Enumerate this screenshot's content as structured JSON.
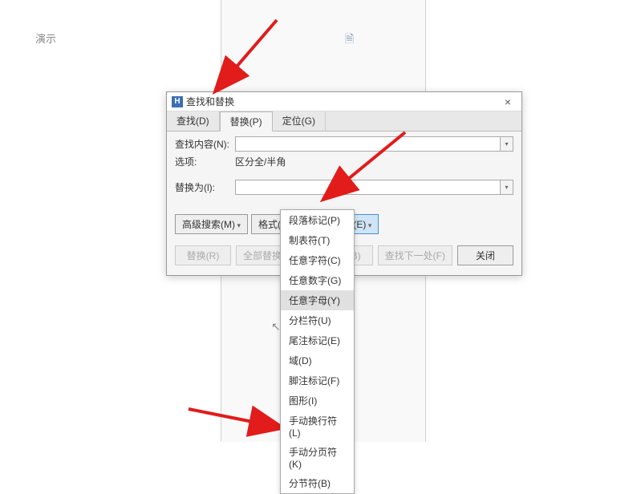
{
  "bgText": "演示",
  "dialog": {
    "title": "查找和替换",
    "tabs": [
      "查找(D)",
      "替换(P)",
      "定位(G)"
    ],
    "findLabel": "查找内容(N):",
    "optionsLabel": "选项:",
    "optionsValue": "区分全/半角",
    "replaceLabel": "替换为(l):",
    "advancedBtn": "高级搜索(M)",
    "formatBtn": "格式(O)",
    "specialBtn": "特殊格式(E)",
    "replaceBtn": "替换(R)",
    "replaceAllBtn": "全部替换(A)",
    "findPrevBtn": "一处(B)",
    "findNextBtn": "查找下一处(F)",
    "closeBtn": "关闭"
  },
  "menu": [
    "段落标记(P)",
    "制表符(T)",
    "任意字符(C)",
    "任意数字(G)",
    "任意字母(Y)",
    "分栏符(U)",
    "尾注标记(E)",
    "域(D)",
    "脚注标记(F)",
    "图形(I)",
    "手动换行符(L)",
    "手动分页符(K)",
    "分节符(B)"
  ]
}
